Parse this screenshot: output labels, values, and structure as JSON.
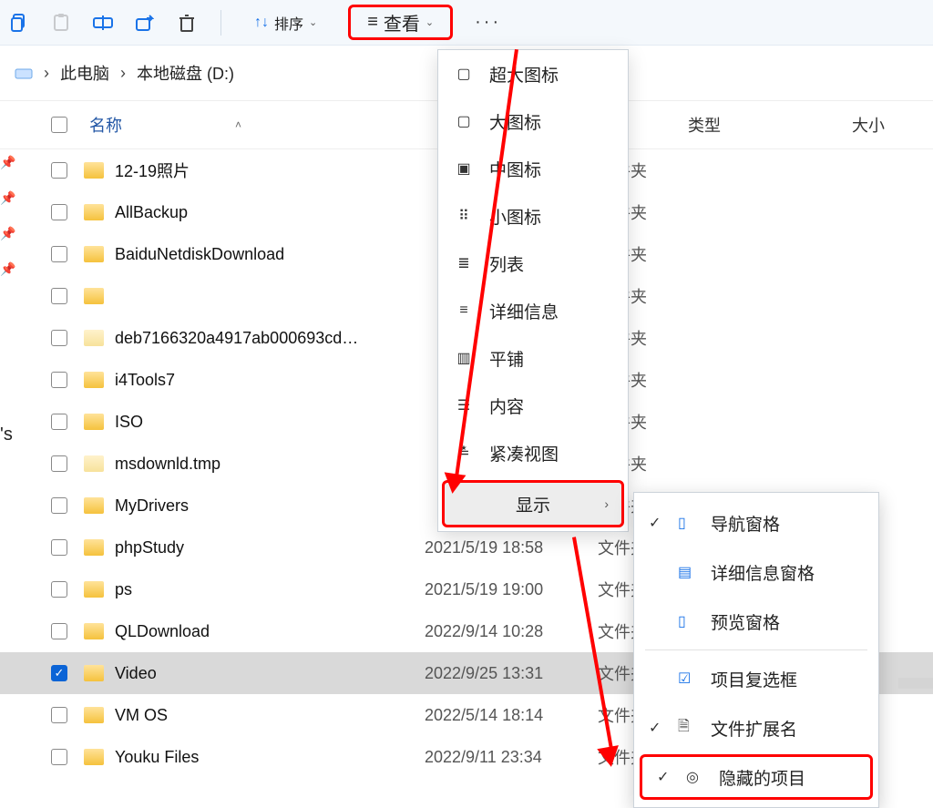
{
  "toolbar": {
    "sort_label": "排序",
    "view_label": "查看"
  },
  "breadcrumb": {
    "root": "此电脑",
    "drive": "本地磁盘 (D:)"
  },
  "columns": {
    "name": "名称",
    "type": "类型",
    "size": "大小"
  },
  "folder_type": "文件夹",
  "files": [
    {
      "name": "12-19照片",
      "date": "",
      "checked": false,
      "pale": false
    },
    {
      "name": "AllBackup",
      "date": "",
      "checked": false,
      "pale": false
    },
    {
      "name": "BaiduNetdiskDownload",
      "date": "",
      "checked": false,
      "pale": false
    },
    {
      "name": "",
      "date": "",
      "checked": false,
      "pale": false,
      "obscured": true
    },
    {
      "name": "deb7166320a4917ab000693cd…",
      "date": "",
      "checked": false,
      "pale": true
    },
    {
      "name": "i4Tools7",
      "date": "",
      "checked": false,
      "pale": false
    },
    {
      "name": "ISO",
      "date": "",
      "checked": false,
      "pale": false
    },
    {
      "name": "msdownld.tmp",
      "date": "",
      "checked": false,
      "pale": true
    },
    {
      "name": "MyDrivers",
      "date": "",
      "checked": false,
      "pale": false
    },
    {
      "name": "phpStudy",
      "date": "2021/5/19 18:58",
      "checked": false,
      "pale": false
    },
    {
      "name": "ps",
      "date": "2021/5/19 19:00",
      "checked": false,
      "pale": false
    },
    {
      "name": "QLDownload",
      "date": "2022/9/14 10:28",
      "checked": false,
      "pale": false
    },
    {
      "name": "Video",
      "date": "2022/9/25 13:31",
      "checked": true,
      "pale": false,
      "selected": true
    },
    {
      "name": "VM OS",
      "date": "2022/5/14 18:14",
      "checked": false,
      "pale": false
    },
    {
      "name": "Youku Files",
      "date": "2022/9/11 23:34",
      "checked": false,
      "pale": false
    }
  ],
  "view_menu": [
    {
      "icon": "▢",
      "label": "超大图标"
    },
    {
      "icon": "▢",
      "label": "大图标"
    },
    {
      "icon": "▣",
      "label": "中图标"
    },
    {
      "icon": "⠿",
      "label": "小图标"
    },
    {
      "icon": "≣",
      "label": "列表"
    },
    {
      "icon": "≡",
      "label": "详细信息"
    },
    {
      "icon": "▥",
      "label": "平铺"
    },
    {
      "icon": "☰",
      "label": "内容"
    },
    {
      "icon": "≛",
      "label": "紧凑视图"
    }
  ],
  "display_label": "显示",
  "show_submenu": {
    "items": [
      {
        "checked": true,
        "icon": "▯",
        "label": "导航窗格",
        "icon_color": "#1a73e8"
      },
      {
        "checked": false,
        "icon": "▤",
        "label": "详细信息窗格",
        "icon_color": "#1a73e8"
      },
      {
        "checked": false,
        "icon": "▯",
        "label": "预览窗格",
        "icon_color": "#1a73e8"
      },
      {
        "checked": false,
        "icon": "☑",
        "label": "项目复选框",
        "icon_color": "#1a73e8"
      },
      {
        "checked": true,
        "icon": "🗎",
        "label": "文件扩展名",
        "icon_color": "#333"
      },
      {
        "checked": true,
        "icon": "◎",
        "label": "隐藏的项目",
        "icon_color": "#333",
        "highlight": true
      }
    ]
  }
}
